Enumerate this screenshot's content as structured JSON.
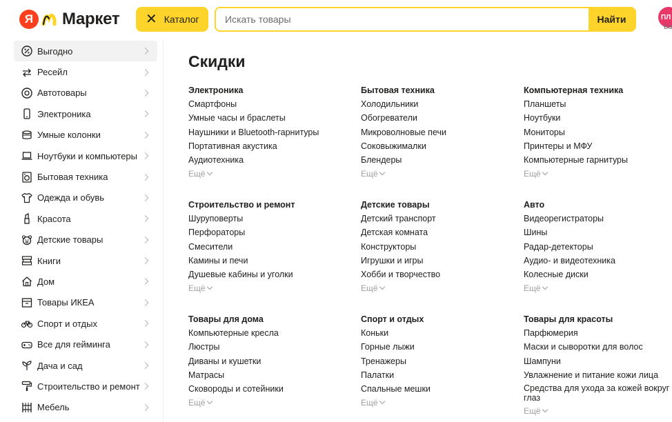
{
  "header": {
    "logo_letter": "Я",
    "logo_text": "Маркет",
    "catalog_label": "Каталог",
    "search_placeholder": "Искать товары",
    "search_button": "Найти",
    "avatar_initials": "ПЛ",
    "avatar_sub": "Ба"
  },
  "sidebar": {
    "items": [
      {
        "label": "Выгодно",
        "icon": "percent-icon"
      },
      {
        "label": "Ресейл",
        "icon": "exchange-icon"
      },
      {
        "label": "Автотовары",
        "icon": "tire-icon"
      },
      {
        "label": "Электроника",
        "icon": "phone-icon"
      },
      {
        "label": "Умные колонки",
        "icon": "speaker-icon"
      },
      {
        "label": "Ноутбуки и компьютеры",
        "icon": "laptop-icon"
      },
      {
        "label": "Бытовая техника",
        "icon": "washer-icon"
      },
      {
        "label": "Одежда и обувь",
        "icon": "shirt-icon"
      },
      {
        "label": "Красота",
        "icon": "lipstick-icon"
      },
      {
        "label": "Детские товары",
        "icon": "bear-icon"
      },
      {
        "label": "Книги",
        "icon": "books-icon"
      },
      {
        "label": "Дом",
        "icon": "house-icon"
      },
      {
        "label": "Товары ИКЕА",
        "icon": "box-icon"
      },
      {
        "label": "Спорт и отдых",
        "icon": "bike-icon"
      },
      {
        "label": "Все для гейминга",
        "icon": "gamepad-icon"
      },
      {
        "label": "Дача и сад",
        "icon": "plant-icon"
      },
      {
        "label": "Строительство и ремонт",
        "icon": "paint-roller-icon"
      },
      {
        "label": "Мебель",
        "icon": "furniture-icon"
      }
    ]
  },
  "main": {
    "title": "Скидки",
    "more_label": "Ещё",
    "columns": [
      [
        {
          "title": "Электроника",
          "links": [
            "Смартфоны",
            "Умные часы и браслеты",
            "Наушники и Bluetooth-гарнитуры",
            "Портативная акустика",
            "Аудиотехника"
          ]
        },
        {
          "title": "Строительство и ремонт",
          "links": [
            "Шуруповерты",
            "Перфораторы",
            "Смесители",
            "Камины и печи",
            "Душевые кабины и уголки"
          ]
        },
        {
          "title": "Товары для дома",
          "links": [
            "Компьютерные кресла",
            "Люстры",
            "Диваны и кушетки",
            "Матрасы",
            "Сковороды и сотейники"
          ]
        }
      ],
      [
        {
          "title": "Бытовая техника",
          "links": [
            "Холодильники",
            "Обогреватели",
            "Микроволновые печи",
            "Соковыжималки",
            "Блендеры"
          ]
        },
        {
          "title": "Детские товары",
          "links": [
            "Детский транспорт",
            "Детская комната",
            "Конструкторы",
            "Игрушки и игры",
            "Хобби и творчество"
          ]
        },
        {
          "title": "Спорт и отдых",
          "links": [
            "Коньки",
            "Горные лыжи",
            "Тренажеры",
            "Палатки",
            "Спальные мешки"
          ]
        }
      ],
      [
        {
          "title": "Компьютерная техника",
          "links": [
            "Планшеты",
            "Ноутбуки",
            "Мониторы",
            "Принтеры и МФУ",
            "Компьютерные гарнитуры"
          ]
        },
        {
          "title": "Авто",
          "links": [
            "Видеорегистраторы",
            "Шины",
            "Радар-детекторы",
            "Аудио- и видеотехника",
            "Колесные диски"
          ]
        },
        {
          "title": "Товары для красоты",
          "links": [
            "Парфюмерия",
            "Маски и сыворотки для волос",
            "Шампуни",
            "Увлажнение и питание кожи лица",
            "Средства для ухода за кожей вокруг глаз"
          ]
        }
      ]
    ]
  },
  "colors": {
    "accent_yellow": "#fed42b",
    "brand_red": "#fc3f1d",
    "text": "#21201f",
    "muted": "#9e9e9e"
  }
}
